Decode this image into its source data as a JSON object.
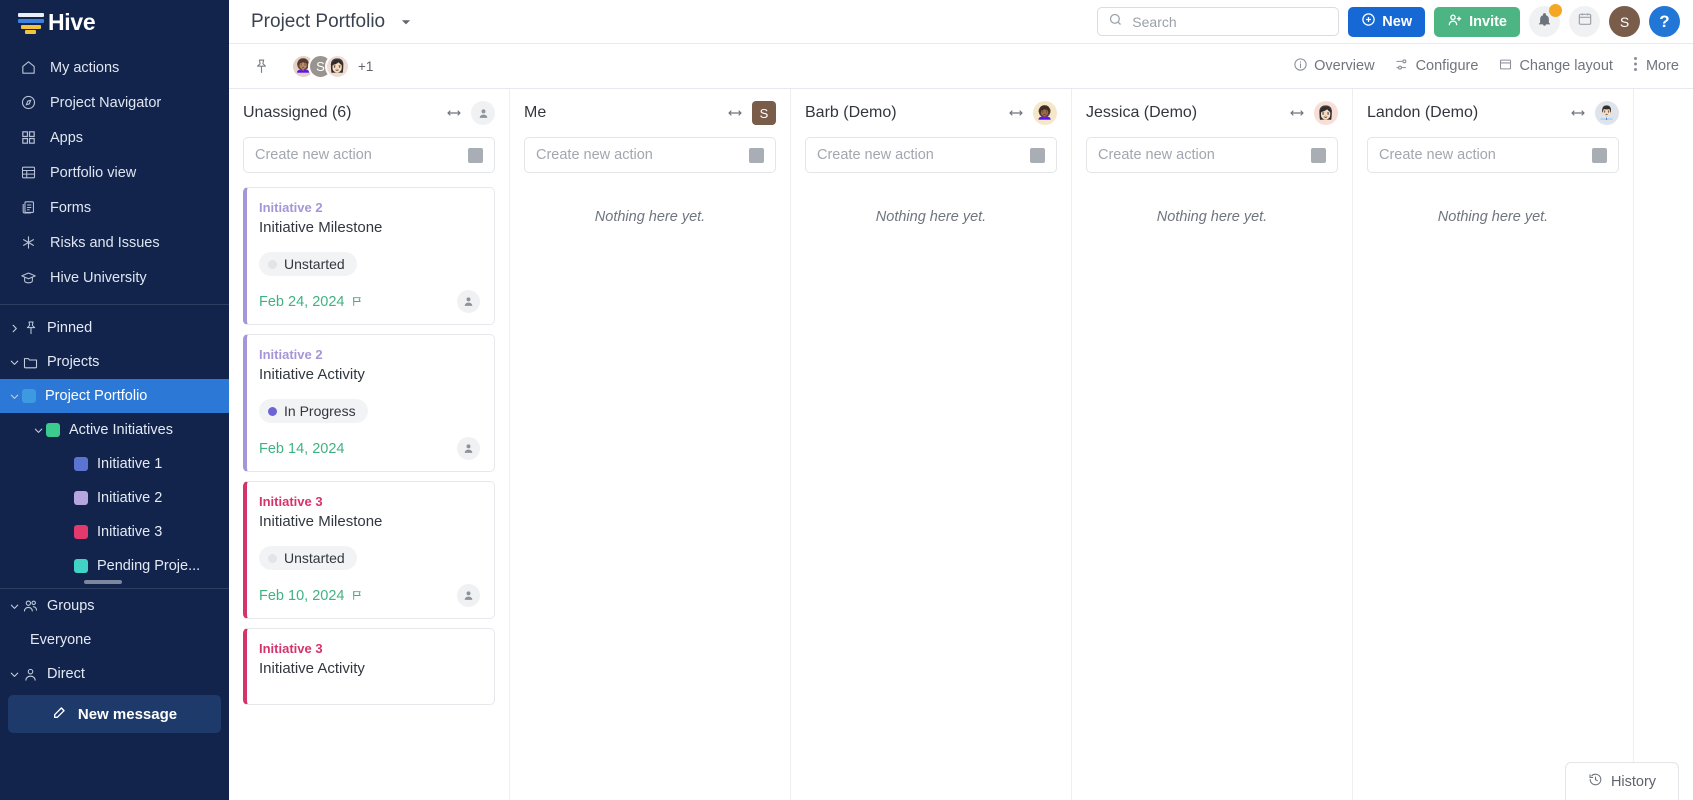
{
  "sidebar": {
    "brand": "Hive",
    "nav": [
      {
        "label": "My actions",
        "icon": "home-icon"
      },
      {
        "label": "Project Navigator",
        "icon": "compass-icon"
      },
      {
        "label": "Apps",
        "icon": "grid-icon"
      },
      {
        "label": "Portfolio view",
        "icon": "table-icon"
      },
      {
        "label": "Forms",
        "icon": "forms-icon"
      },
      {
        "label": "Risks and Issues",
        "icon": "asterisk-icon"
      },
      {
        "label": "Hive University",
        "icon": "graduation-cap-icon"
      }
    ],
    "tree": [
      {
        "label": "Pinned",
        "icon": "pin-icon",
        "caret": "right",
        "indent": 1,
        "selected": false
      },
      {
        "label": "Projects",
        "icon": "folder-icon",
        "caret": "down",
        "indent": 1,
        "selected": false
      },
      {
        "label": "Project Portfolio",
        "swatch": "#3e9ae0",
        "caret": "down",
        "indent": 1,
        "selected": true
      },
      {
        "label": "Active Initiatives",
        "swatch": "#3ccb8e",
        "caret": "down",
        "indent": 2,
        "selected": false
      },
      {
        "label": "Initiative 1",
        "swatch": "#5b74d1",
        "caret": "none",
        "indent": 3,
        "selected": false
      },
      {
        "label": "Initiative 2",
        "swatch": "#b6a6e0",
        "caret": "none",
        "indent": 3,
        "selected": false
      },
      {
        "label": "Initiative 3",
        "swatch": "#e33a6e",
        "caret": "none",
        "indent": 3,
        "selected": false
      },
      {
        "label": "Pending Proje...",
        "swatch": "#40d3c6",
        "caret": "none",
        "indent": 3,
        "selected": false
      }
    ],
    "groups": [
      {
        "label": "Groups",
        "icon": "people-icon",
        "caret": "down",
        "indent": 1
      },
      {
        "label": "Everyone",
        "icon": "none",
        "caret": "none",
        "indent": 1
      },
      {
        "label": "Direct",
        "icon": "person-icon",
        "caret": "down",
        "indent": 1
      }
    ],
    "new_message": {
      "label": "New message",
      "icon": "compose-icon"
    }
  },
  "topbar": {
    "project_title": "Project Portfolio",
    "caret_icon": "chevron-down-icon",
    "search": {
      "placeholder": "Search",
      "value": "",
      "icon": "search-icon"
    },
    "new_button": {
      "label": "New",
      "icon": "plus-circle-icon",
      "color": "#1668d4"
    },
    "invite_button": {
      "label": "Invite",
      "icon": "user-plus-icon",
      "color": "#4cb583"
    },
    "bell": {
      "icon": "bell-icon",
      "badge": true,
      "badge_color": "#f5a623"
    },
    "calendar": {
      "icon": "calendar-icon"
    },
    "user_avatar": {
      "initial": "S",
      "color": "#7a5c4b"
    },
    "help": {
      "label": "?",
      "color": "#2277d6"
    }
  },
  "toolbar": {
    "pin_icon": "pin-icon",
    "members": [
      {
        "emoji": "👩🏽‍🦱",
        "bg": "#e6d2c0"
      },
      {
        "initial": "S",
        "bg": "#9a9490"
      },
      {
        "emoji": "👩🏻",
        "bg": "#f1dcd4"
      }
    ],
    "more_members": "+1",
    "actions": [
      {
        "label": "Overview",
        "icon": "info-icon"
      },
      {
        "label": "Configure",
        "icon": "sliders-icon"
      },
      {
        "label": "Change layout",
        "icon": "layout-icon"
      },
      {
        "label": "More",
        "icon": "dots-vertical-icon"
      }
    ]
  },
  "board": {
    "create_placeholder": "Create new action",
    "empty_text": "Nothing here yet.",
    "columns": [
      {
        "title": "Unassigned (6)",
        "avatar": {
          "type": "icon",
          "icon": "person-icon"
        },
        "cards": [
          {
            "project": "Initiative 2",
            "project_color": "#a596d9",
            "accent": "#a596d9",
            "title": "Initiative Milestone",
            "status": "Unstarted",
            "status_dot": "#e2e4e7",
            "date": "Feb 24, 2024",
            "date_color": "#3fb37f",
            "has_flag": true
          },
          {
            "project": "Initiative 2",
            "project_color": "#a596d9",
            "accent": "#a596d9",
            "title": "Initiative Activity",
            "status": "In Progress",
            "status_dot": "#6f63d8",
            "date": "Feb 14, 2024",
            "date_color": "#3fb37f",
            "has_flag": false
          },
          {
            "project": "Initiative 3",
            "project_color": "#d6336c",
            "accent": "#d6336c",
            "title": "Initiative Milestone",
            "status": "Unstarted",
            "status_dot": "#e2e4e7",
            "date": "Feb 10, 2024",
            "date_color": "#3fb37f",
            "has_flag": true
          },
          {
            "project": "Initiative 3",
            "project_color": "#d6336c",
            "accent": "#d6336c",
            "title": "Initiative Activity",
            "status": "",
            "status_dot": "",
            "date": "",
            "date_color": "#3fb37f",
            "has_flag": false
          }
        ]
      },
      {
        "title": "Me",
        "avatar": {
          "type": "square",
          "initial": "S",
          "bg": "#7a5c4b"
        },
        "cards": []
      },
      {
        "title": "Barb (Demo)",
        "avatar": {
          "type": "emoji",
          "emoji": "👩🏾‍🦱",
          "bg": "#f6e7c8"
        },
        "cards": []
      },
      {
        "title": "Jessica (Demo)",
        "avatar": {
          "type": "emoji",
          "emoji": "👩🏻",
          "bg": "#f7dfd8"
        },
        "cards": []
      },
      {
        "title": "Landon (Demo)",
        "avatar": {
          "type": "emoji",
          "emoji": "👨🏻‍💼",
          "bg": "#dfe4ea"
        },
        "cards": []
      }
    ]
  },
  "history_button": {
    "label": "History",
    "icon": "history-icon"
  }
}
